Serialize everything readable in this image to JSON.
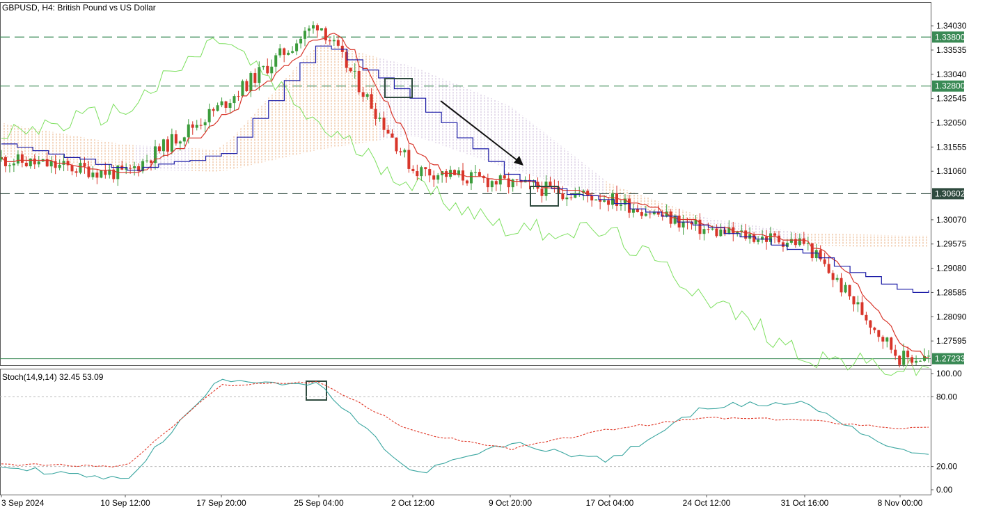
{
  "main": {
    "title": "GBPUSD, H4:  British Pound vs US Dollar",
    "price_axis": [
      "1.34030",
      "1.33535",
      "1.33040",
      "1.32545",
      "1.32050",
      "1.31555",
      "1.31060",
      "1.30070",
      "1.29575",
      "1.29080",
      "1.28585",
      "1.28090",
      "1.27595"
    ],
    "levels": [
      {
        "value": 1.338,
        "label": "1.33800",
        "color": "#3a8a55"
      },
      {
        "value": 1.328,
        "label": "1.32800",
        "color": "#3a8a55"
      },
      {
        "value": 1.30602,
        "label": "1.30602",
        "color": "#2e4a3e"
      }
    ],
    "current_price": {
      "value": 1.27233,
      "label": "1.27233",
      "color": "#3a8a55"
    }
  },
  "sub": {
    "title": "Stoch(14,9,14) 32.45 53.09",
    "axis": [
      "100.00",
      "80.00",
      "20.00",
      "0.00"
    ]
  },
  "x_axis": [
    "3 Sep 2024",
    "10 Sep 12:00",
    "17 Sep 20:00",
    "25 Sep 04:00",
    "2 Oct 12:00",
    "9 Oct 20:00",
    "17 Oct 04:00",
    "24 Oct 12:00",
    "31 Oct 16:00",
    "8 Nov 00:00"
  ],
  "chart_data": [
    {
      "type": "line",
      "title": "GBPUSD, H4:  British Pound vs US Dollar",
      "xlabel": "",
      "ylabel": "",
      "ylim": [
        1.271,
        1.345
      ],
      "grid": false,
      "x": [
        "3 Sep 2024",
        "10 Sep 12:00",
        "17 Sep 20:00",
        "25 Sep 04:00",
        "2 Oct 12:00",
        "9 Oct 20:00",
        "17 Oct 04:00",
        "24 Oct 12:00",
        "31 Oct 16:00",
        "8 Nov 00:00"
      ],
      "series": [
        {
          "name": "Close",
          "color": "#e0402a",
          "values": [
            1.313,
            1.31,
            1.324,
            1.341,
            1.311,
            1.308,
            1.305,
            1.2985,
            1.296,
            1.2725
          ]
        },
        {
          "name": "Kijun-sen",
          "color": "#1a1aa6",
          "values": [
            1.316,
            1.311,
            1.314,
            1.337,
            1.325,
            1.309,
            1.304,
            1.299,
            1.294,
            1.286
          ]
        },
        {
          "name": "Chikou Span",
          "color": "#7ee060",
          "values": [
            1.318,
            1.323,
            1.338,
            1.32,
            1.308,
            1.299,
            1.298,
            1.285,
            1.273,
            1.27
          ]
        }
      ],
      "annotations": [
        "1.33800",
        "1.32800",
        "1.30602",
        "1.27233"
      ]
    },
    {
      "type": "line",
      "title": "Stoch(14,9,14) 32.45 53.09",
      "ylim": [
        0,
        100
      ],
      "levels": [
        20,
        80
      ],
      "x": [
        "3 Sep 2024",
        "10 Sep 12:00",
        "17 Sep 20:00",
        "25 Sep 04:00",
        "2 Oct 12:00",
        "9 Oct 20:00",
        "17 Oct 04:00",
        "24 Oct 12:00",
        "31 Oct 16:00",
        "8 Nov 00:00"
      ],
      "series": [
        {
          "name": "Main",
          "color": "#3aa6a0",
          "values": [
            20,
            8,
            96,
            90,
            13,
            40,
            25,
            72,
            75,
            32.45
          ]
        },
        {
          "name": "Signal",
          "color": "#e03a2a",
          "values": [
            22,
            20,
            90,
            93,
            50,
            35,
            52,
            62,
            60,
            53.09
          ]
        }
      ]
    }
  ]
}
